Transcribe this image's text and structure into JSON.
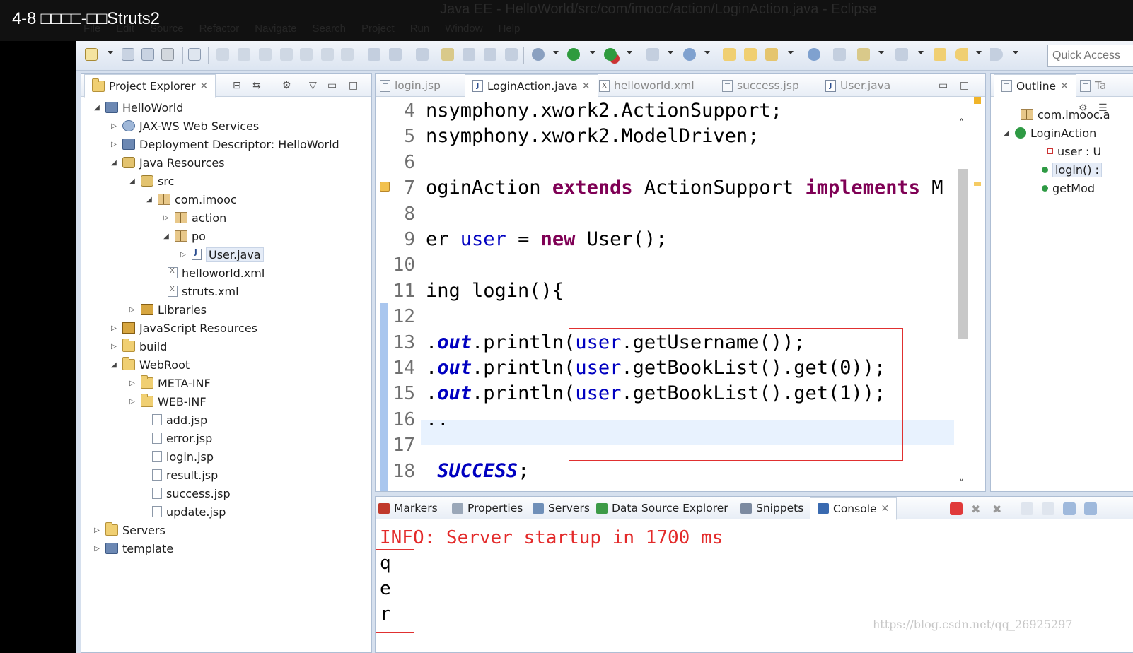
{
  "video": {
    "title": "4-8 □□□□-□□Struts2"
  },
  "window": {
    "title": "Java EE - HelloWorld/src/com/imooc/action/LoginAction.java - Eclipse"
  },
  "menu": [
    "File",
    "Edit",
    "Source",
    "Refactor",
    "Navigate",
    "Search",
    "Project",
    "Run",
    "Window",
    "Help"
  ],
  "toolbar": {
    "quick_access_placeholder": "Quick Access"
  },
  "explorer": {
    "tab_label": "Project Explorer",
    "tree": [
      {
        "label": "HelloWorld",
        "icon": "project-icon",
        "twisty": "expanded"
      },
      {
        "label": "JAX-WS Web Services",
        "icon": "web-services-icon",
        "twisty": "collapsed"
      },
      {
        "label": "Deployment Descriptor: HelloWorld",
        "icon": "deployment-descriptor-icon",
        "twisty": "collapsed"
      },
      {
        "label": "Java Resources",
        "icon": "java-resources-icon",
        "twisty": "expanded"
      },
      {
        "label": "src",
        "icon": "source-folder-icon",
        "twisty": "expanded"
      },
      {
        "label": "com.imooc",
        "icon": "package-icon",
        "twisty": "expanded"
      },
      {
        "label": "action",
        "icon": "package-icon",
        "twisty": "collapsed"
      },
      {
        "label": "po",
        "icon": "package-icon",
        "twisty": "expanded"
      },
      {
        "label": "User.java",
        "icon": "java-file-icon",
        "twisty": "collapsed",
        "selected": true
      },
      {
        "label": "helloworld.xml",
        "icon": "xml-file-icon",
        "twisty": "none"
      },
      {
        "label": "struts.xml",
        "icon": "xml-file-icon",
        "twisty": "none"
      },
      {
        "label": "Libraries",
        "icon": "libraries-icon",
        "twisty": "collapsed"
      },
      {
        "label": "JavaScript Resources",
        "icon": "libraries-icon",
        "twisty": "collapsed"
      },
      {
        "label": "build",
        "icon": "folder-icon",
        "twisty": "collapsed"
      },
      {
        "label": "WebRoot",
        "icon": "folder-icon",
        "twisty": "expanded"
      },
      {
        "label": "META-INF",
        "icon": "folder-icon",
        "twisty": "collapsed"
      },
      {
        "label": "WEB-INF",
        "icon": "folder-icon",
        "twisty": "collapsed"
      },
      {
        "label": "add.jsp",
        "icon": "jsp-file-icon",
        "twisty": "none"
      },
      {
        "label": "error.jsp",
        "icon": "jsp-file-icon",
        "twisty": "none"
      },
      {
        "label": "login.jsp",
        "icon": "jsp-file-icon",
        "twisty": "none"
      },
      {
        "label": "result.jsp",
        "icon": "jsp-file-icon",
        "twisty": "none"
      },
      {
        "label": "success.jsp",
        "icon": "jsp-file-icon",
        "twisty": "none"
      },
      {
        "label": "update.jsp",
        "icon": "jsp-file-icon",
        "twisty": "none"
      },
      {
        "label": "Servers",
        "icon": "folder-icon",
        "twisty": "collapsed"
      },
      {
        "label": "template",
        "icon": "project-icon",
        "twisty": "collapsed"
      }
    ]
  },
  "editor": {
    "tabs": [
      {
        "label": "login.jsp",
        "active": false
      },
      {
        "label": "LoginAction.java",
        "active": true
      },
      {
        "label": "helloworld.xml",
        "active": false
      },
      {
        "label": "success.jsp",
        "active": false
      },
      {
        "label": "User.java",
        "active": false
      }
    ],
    "lines": [
      {
        "n": "4",
        "parts": [
          [
            "p",
            "nsymphony.xwork2.ActionSupport;"
          ]
        ]
      },
      {
        "n": "5",
        "parts": [
          [
            "p",
            "nsymphony.xwork2.ModelDriven;"
          ]
        ]
      },
      {
        "n": "6",
        "parts": []
      },
      {
        "n": "7",
        "parts": [
          [
            "p",
            "oginAction "
          ],
          [
            "kw",
            "extends"
          ],
          [
            "p",
            " ActionSupport "
          ],
          [
            "kw",
            "implements"
          ],
          [
            "p",
            " M"
          ]
        ]
      },
      {
        "n": "8",
        "parts": []
      },
      {
        "n": "9",
        "parts": [
          [
            "p",
            "er "
          ],
          [
            "fld",
            "user"
          ],
          [
            "p",
            " = "
          ],
          [
            "kw",
            "new"
          ],
          [
            "p",
            " User();"
          ]
        ]
      },
      {
        "n": "10",
        "parts": []
      },
      {
        "n": "11",
        "parts": [
          [
            "p",
            "ing login(){"
          ]
        ]
      },
      {
        "n": "12",
        "parts": []
      },
      {
        "n": "13",
        "parts": [
          [
            "p",
            "."
          ],
          [
            "sfld",
            "out"
          ],
          [
            "p",
            ".println("
          ],
          [
            "fld",
            "user"
          ],
          [
            "p",
            ".getUsername());"
          ]
        ]
      },
      {
        "n": "14",
        "parts": [
          [
            "p",
            "."
          ],
          [
            "sfld",
            "out"
          ],
          [
            "p",
            ".println("
          ],
          [
            "fld",
            "user"
          ],
          [
            "p",
            ".getBookList().get(0));"
          ]
        ]
      },
      {
        "n": "15",
        "parts": [
          [
            "p",
            "."
          ],
          [
            "sfld",
            "out"
          ],
          [
            "p",
            ".println("
          ],
          [
            "fld",
            "user"
          ],
          [
            "p",
            ".getBookList().get(1));"
          ]
        ]
      },
      {
        "n": "16",
        "parts": [
          [
            "p",
            ".."
          ]
        ]
      },
      {
        "n": "17",
        "parts": []
      },
      {
        "n": "18",
        "parts": [
          [
            "p",
            " "
          ],
          [
            "sfld",
            "SUCCESS"
          ],
          [
            "p",
            ";"
          ]
        ]
      }
    ]
  },
  "outline": {
    "tab_label": "Outline",
    "second_tab_label": "Ta",
    "items": [
      {
        "label": "com.imooc.a",
        "icon": "package-icon"
      },
      {
        "label": "LoginAction",
        "icon": "class-icon"
      },
      {
        "label": "user : U",
        "icon": "private-field-icon"
      },
      {
        "label": "login() :",
        "icon": "public-method-icon",
        "selected": true
      },
      {
        "label": "getMod",
        "icon": "public-method-icon"
      }
    ]
  },
  "bottom_tabs": [
    {
      "label": "Markers",
      "icon": "markers-icon"
    },
    {
      "label": "Properties",
      "icon": "properties-icon"
    },
    {
      "label": "Servers",
      "icon": "servers-icon"
    },
    {
      "label": "Data Source Explorer",
      "icon": "data-source-icon"
    },
    {
      "label": "Snippets",
      "icon": "snippets-icon"
    },
    {
      "label": "Console",
      "icon": "console-icon",
      "active": true
    }
  ],
  "console": {
    "info_line": "INFO: Server startup in 1700 ms",
    "output": [
      "q",
      "e",
      "r"
    ]
  },
  "watermark": "https://blog.csdn.net/qq_26925297",
  "colors": {
    "keyword": "#7f0055",
    "field": "#0000c0",
    "console_info": "#e32a2a",
    "highlight_box": "#e03030"
  }
}
